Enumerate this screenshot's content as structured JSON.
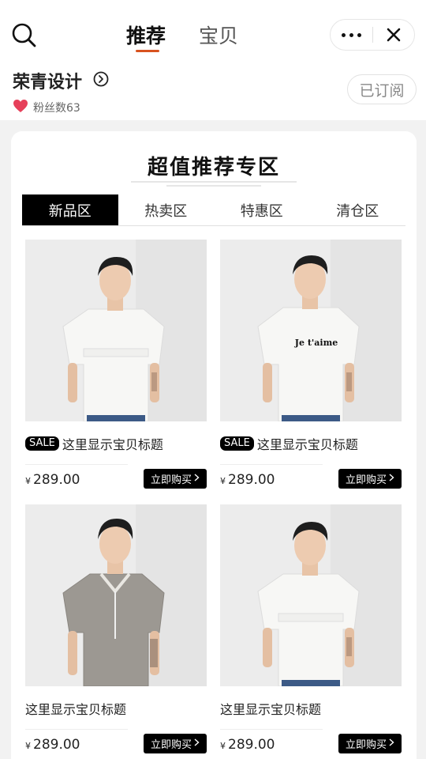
{
  "header": {
    "tabs": [
      {
        "label": "推荐",
        "active": true
      },
      {
        "label": "宝贝",
        "active": false
      }
    ],
    "icons": [
      "search-icon",
      "more-icon",
      "close-icon"
    ]
  },
  "shop": {
    "name": "荣青设计",
    "fans_label": "粉丝数63",
    "subscribe_label": "已订阅"
  },
  "section": {
    "title": "超值推荐专区",
    "categories": [
      {
        "label": "新品区",
        "active": true
      },
      {
        "label": "热卖区",
        "active": false
      },
      {
        "label": "特惠区",
        "active": false
      },
      {
        "label": "清仓区",
        "active": false
      }
    ]
  },
  "products": [
    {
      "badge": "SALE",
      "title": "这里显示宝贝标题",
      "currency": "¥",
      "price": "289.00",
      "buy_label": "立即购买",
      "shirt": "white-tee",
      "shirt_text": ""
    },
    {
      "badge": "SALE",
      "title": "这里显示宝贝标题",
      "currency": "¥",
      "price": "289.00",
      "buy_label": "立即购买",
      "shirt": "white-tee",
      "shirt_text": "Je t'aime"
    },
    {
      "badge": "",
      "title": "这里显示宝贝标题",
      "currency": "¥",
      "price": "289.00",
      "buy_label": "立即购买",
      "shirt": "grey-polo",
      "shirt_text": ""
    },
    {
      "badge": "",
      "title": "这里显示宝贝标题",
      "currency": "¥",
      "price": "289.00",
      "buy_label": "立即购买",
      "shirt": "white-tee",
      "shirt_text": ""
    }
  ],
  "colors": {
    "accent_underline": "#d8531f",
    "heart": "#e6405a",
    "tab_active_bg": "#000000"
  }
}
